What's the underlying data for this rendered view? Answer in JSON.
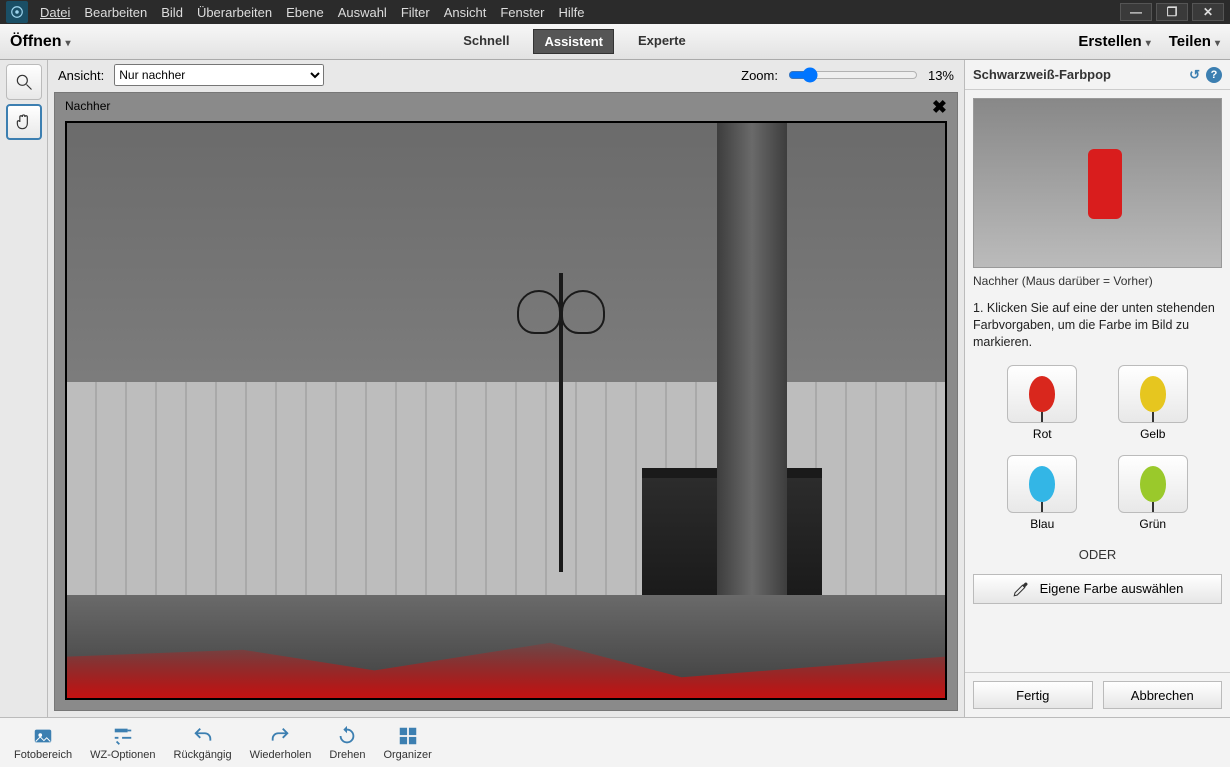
{
  "menu": {
    "items": [
      "Datei",
      "Bearbeiten",
      "Bild",
      "Überarbeiten",
      "Ebene",
      "Auswahl",
      "Filter",
      "Ansicht",
      "Fenster",
      "Hilfe"
    ]
  },
  "window_controls": {
    "min": "—",
    "max": "❐",
    "close": "✕"
  },
  "actionbar": {
    "open": "Öffnen",
    "modes": {
      "quick": "Schnell",
      "guided": "Assistent",
      "expert": "Experte"
    },
    "create": "Erstellen",
    "share": "Teilen"
  },
  "canvas": {
    "view_label": "Ansicht:",
    "view_option": "Nur nachher",
    "zoom_label": "Zoom:",
    "zoom_value": "13%",
    "image_label": "Nachher"
  },
  "panel": {
    "title": "Schwarzweiß-Farbpop",
    "caption": "Nachher (Maus darüber = Vorher)",
    "instruction": "1. Klicken Sie auf eine der unten stehenden Farbvorgaben, um die Farbe im Bild zu markieren.",
    "swatches": {
      "red": "Rot",
      "yellow": "Gelb",
      "blue": "Blau",
      "green": "Grün"
    },
    "or": "ODER",
    "custom": "Eigene Farbe auswählen",
    "done": "Fertig",
    "cancel": "Abbrechen"
  },
  "bottom": {
    "photobin": "Fotobereich",
    "tooloptions": "WZ-Optionen",
    "undo": "Rückgängig",
    "redo": "Wiederholen",
    "rotate": "Drehen",
    "organizer": "Organizer"
  },
  "colors": {
    "red": "#d9271d",
    "yellow": "#e6c61f",
    "blue": "#33b6e6",
    "green": "#9ac92b"
  }
}
